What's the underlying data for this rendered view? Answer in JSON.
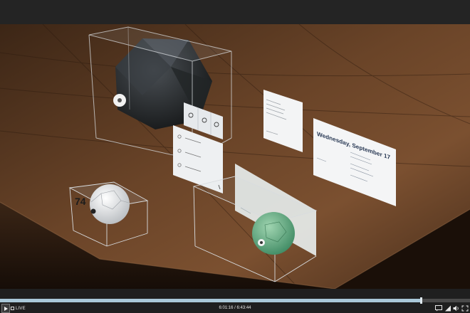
{
  "player": {
    "live_label": "LIVE",
    "time": {
      "current": "6:01:16",
      "separator": "/",
      "total": "6:43:44"
    },
    "progress_fraction": 0.895,
    "icons": {
      "play": "play-icon",
      "live": "live-indicator-icon",
      "captions": "captions-icon",
      "quality": "signal-quality-icon",
      "volume": "volume-icon",
      "fullscreen": "fullscreen-icon"
    }
  },
  "scene": {
    "cube_number": "74",
    "calendar_heading": "Wednesday, September 17"
  },
  "colors": {
    "accent": "#a9c8d8",
    "bar_bg": "#1f1f1f",
    "track": "#4a4a4a"
  }
}
